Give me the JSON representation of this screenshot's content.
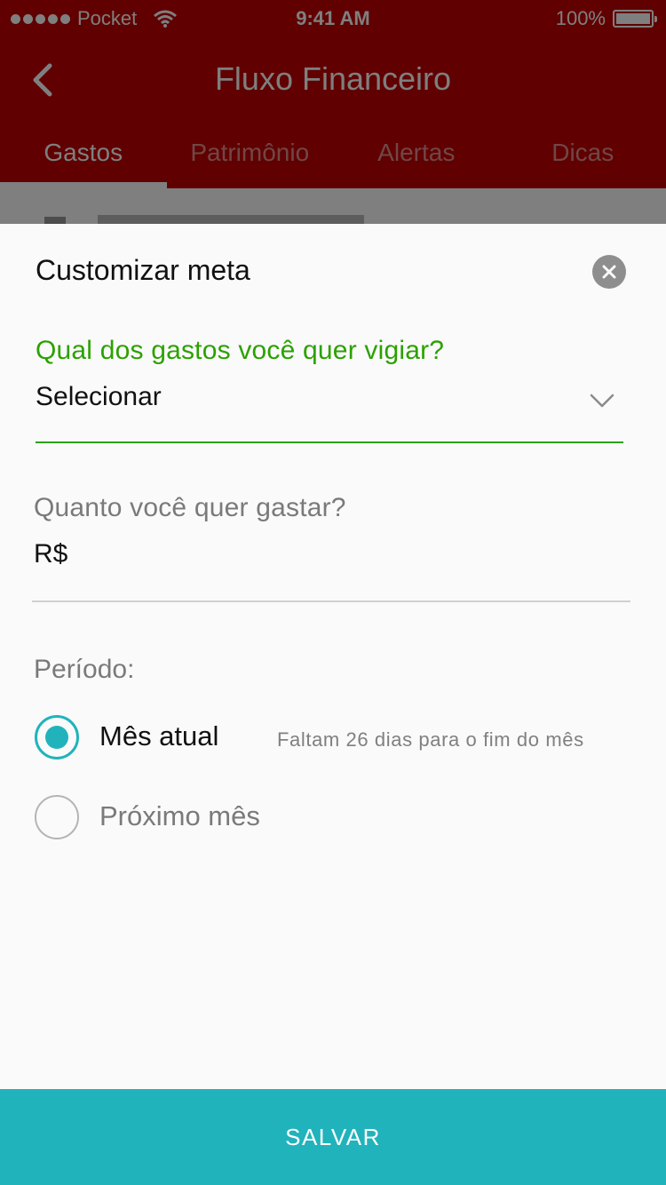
{
  "status_bar": {
    "carrier": "Pocket",
    "time": "9:41 AM",
    "battery": "100%"
  },
  "header": {
    "title": "Fluxo Financeiro",
    "back_icon": "chevron-left-icon"
  },
  "tabs": [
    {
      "label": "Gastos",
      "active": true
    },
    {
      "label": "Patrimônio",
      "active": false
    },
    {
      "label": "Alertas",
      "active": false
    },
    {
      "label": "Dicas",
      "active": false
    }
  ],
  "modal": {
    "title": "Customizar meta",
    "close_icon": "close-icon",
    "expense_question": "Qual dos gastos você quer vigiar?",
    "expense_select_value": "Selecionar",
    "amount_question": "Quanto você quer gastar?",
    "currency_prefix": "R$",
    "period_label": "Período:",
    "period_options": [
      {
        "label": "Mês atual",
        "hint": "Faltam 26 dias para o fim do mês",
        "selected": true
      },
      {
        "label": "Próximo mês",
        "hint": "",
        "selected": false
      }
    ],
    "save_label": "SALVAR"
  },
  "colors": {
    "header_red": "#c00000",
    "focus_green": "#2ca100",
    "accent_teal": "#21b3bc"
  }
}
